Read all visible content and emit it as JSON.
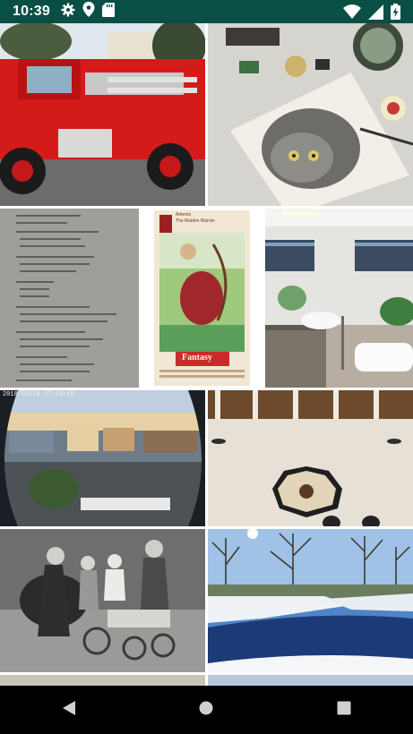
{
  "status_bar": {
    "time": "10:39",
    "left_icons": [
      "gear-icon",
      "location-pin-icon",
      "sd-card-icon"
    ],
    "right_icons": [
      "wifi-icon",
      "signal-icon",
      "battery-charging-icon"
    ]
  },
  "photos": [
    {
      "name": "fire-truck-photo",
      "text": ""
    },
    {
      "name": "watercolor-cat-photo",
      "text": ""
    },
    {
      "name": "handwritten-menu-photo",
      "text": ""
    },
    {
      "name": "tarot-card-archer-photo",
      "text": ""
    },
    {
      "name": "bathroom-photo",
      "text": ""
    },
    {
      "name": "fisheye-town-photo",
      "text": "2018/03/24 17:19:10"
    },
    {
      "name": "marble-hall-photo",
      "text": ""
    },
    {
      "name": "vintage-children-photo",
      "text": ""
    },
    {
      "name": "winter-creek-photo",
      "text": ""
    }
  ],
  "card": {
    "subtitle": "Artemis",
    "title": "The Maiden Warrior",
    "logo": "Fantasy"
  },
  "nav": [
    "back-icon",
    "home-icon",
    "recents-icon"
  ],
  "colors": {
    "status_bar": "#0a4f45",
    "nav_bar": "#000000"
  }
}
